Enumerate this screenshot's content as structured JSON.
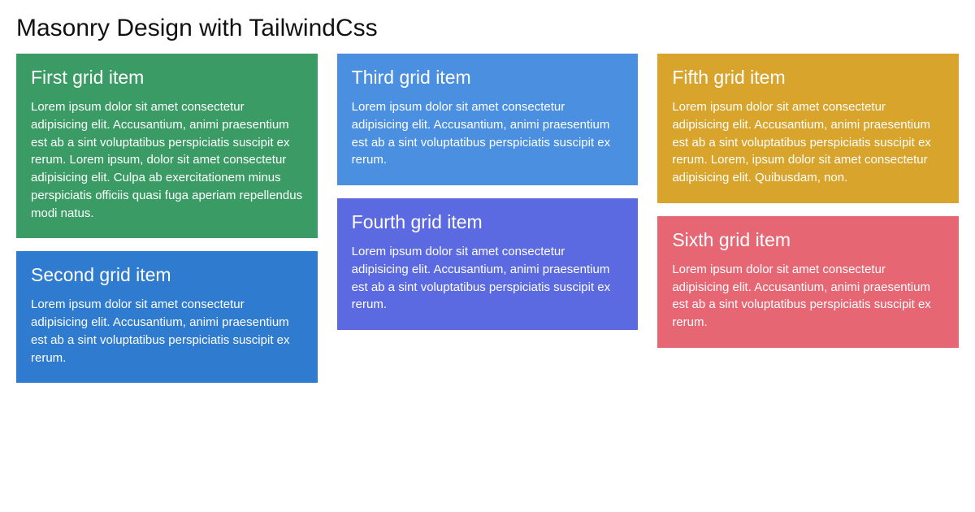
{
  "page": {
    "title": "Masonry Design with TailwindCss"
  },
  "cards": [
    {
      "title": "First grid item",
      "body": "Lorem ipsum dolor sit amet consectetur adipisicing elit. Accusantium, animi praesentium est ab a sint voluptatibus perspiciatis suscipit ex rerum. Lorem ipsum, dolor sit amet consectetur adipisicing elit. Culpa ab exercitationem minus perspiciatis officiis quasi fuga aperiam repellendus modi natus.",
      "color": "#3a9b64"
    },
    {
      "title": "Second grid item",
      "body": "Lorem ipsum dolor sit amet consectetur adipisicing elit. Accusantium, animi praesentium est ab a sint voluptatibus perspiciatis suscipit ex rerum.",
      "color": "#2f7bcf"
    },
    {
      "title": "Third grid item",
      "body": "Lorem ipsum dolor sit amet consectetur adipisicing elit. Accusantium, animi praesentium est ab a sint voluptatibus perspiciatis suscipit ex rerum.",
      "color": "#4b8fe0"
    },
    {
      "title": "Fourth grid item",
      "body": "Lorem ipsum dolor sit amet consectetur adipisicing elit. Accusantium, animi praesentium est ab a sint voluptatibus perspiciatis suscipit ex rerum.",
      "color": "#5b6ae0"
    },
    {
      "title": "Fifth grid item",
      "body": "Lorem ipsum dolor sit amet consectetur adipisicing elit. Accusantium, animi praesentium est ab a sint voluptatibus perspiciatis suscipit ex rerum. Lorem, ipsum dolor sit amet consectetur adipisicing elit. Quibusdam, non.",
      "color": "#d8a42c"
    },
    {
      "title": "Sixth grid item",
      "body": "Lorem ipsum dolor sit amet consectetur adipisicing elit. Accusantium, animi praesentium est ab a sint voluptatibus perspiciatis suscipit ex rerum.",
      "color": "#e76673"
    }
  ]
}
